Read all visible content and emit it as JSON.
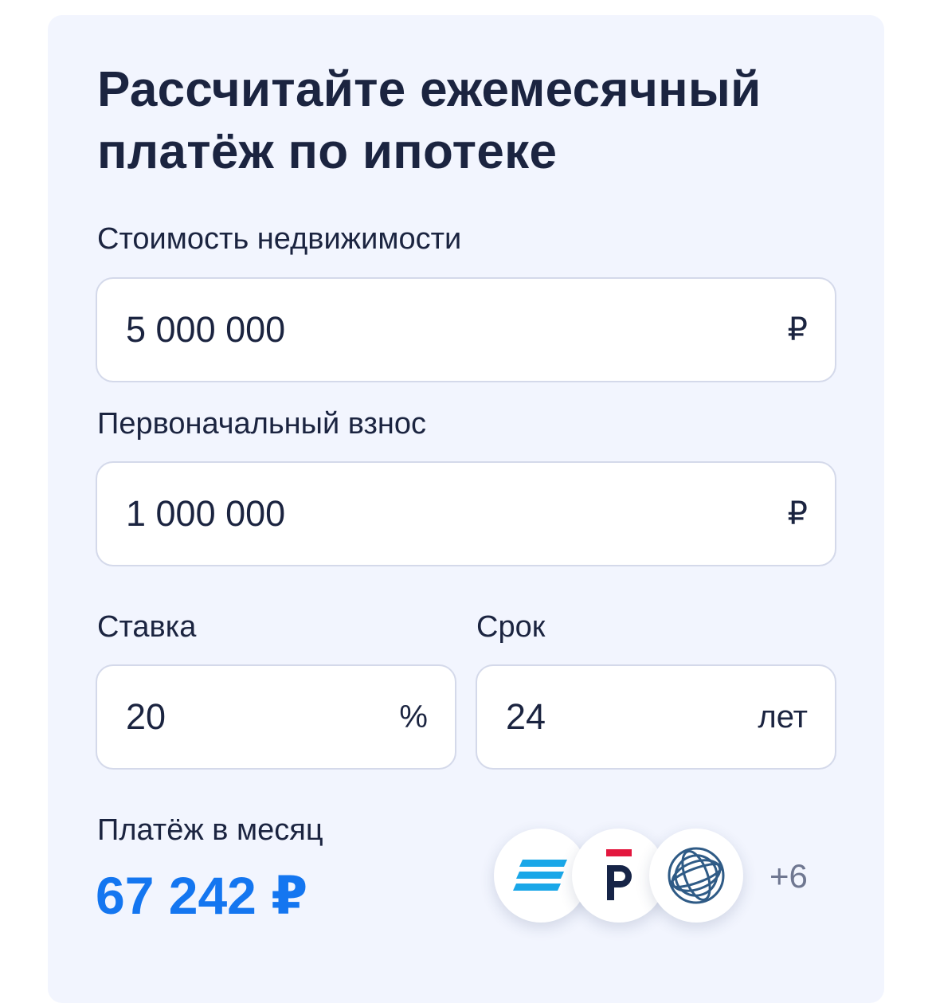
{
  "calculator": {
    "title": "Рассчитайте ежемесячный платёж по ипотеке",
    "property_cost": {
      "label": "Стоимость недвижимости",
      "value": "5 000 000",
      "unit": "₽"
    },
    "down_payment": {
      "label": "Первоначальный взнос",
      "value": "1 000 000",
      "unit": "₽"
    },
    "rate": {
      "label": "Ставка",
      "value": "20",
      "unit": "%"
    },
    "term": {
      "label": "Срок",
      "value": "24",
      "unit": "лет"
    },
    "result": {
      "label": "Платёж в месяц",
      "amount": "67 242 ₽"
    },
    "banks": {
      "logos": [
        "stripes-bank-logo",
        "p-bank-logo",
        "globe-bank-logo"
      ],
      "more_label": "+6"
    }
  },
  "colors": {
    "card_background": "#f2f5fe",
    "text_primary": "#1b2440",
    "accent_blue": "#1476f0",
    "field_border": "#d4d9ea",
    "muted_text": "#6f7791"
  }
}
